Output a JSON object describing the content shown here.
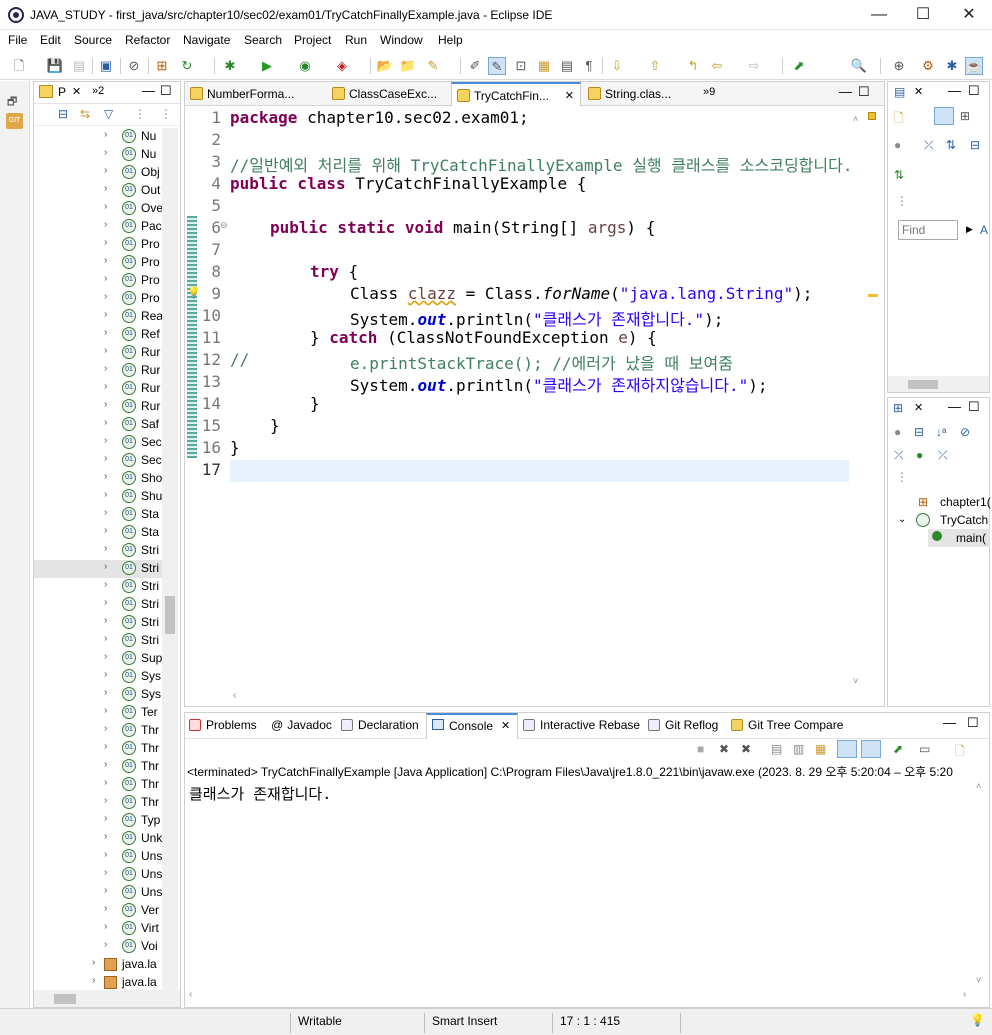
{
  "window": {
    "title": "JAVA_STUDY - first_java/src/chapter10/sec02/exam01/TryCatchFinallyExample.java - Eclipse IDE",
    "minimize": "—",
    "maximize": "☐",
    "close": "✕"
  },
  "menu": [
    "File",
    "Edit",
    "Source",
    "Refactor",
    "Navigate",
    "Search",
    "Project",
    "Run",
    "Window",
    "Help"
  ],
  "package_explorer": {
    "tab_label": "P",
    "tab_extra": "»2",
    "items": [
      "Nu",
      "Nu",
      "Obj",
      "Out",
      "Ove",
      "Pac",
      "Pro",
      "Pro",
      "Pro",
      "Pro",
      "Rea",
      "Ref",
      "Rur",
      "Rur",
      "Rur",
      "Rur",
      "Saf",
      "Sec",
      "Sec",
      "Sho",
      "Shu",
      "Sta",
      "Sta",
      "Stri",
      "Stri",
      "Stri",
      "Stri",
      "Stri",
      "Stri",
      "Sup",
      "Sys",
      "Sys",
      "Ter",
      "Thr",
      "Thr",
      "Thr",
      "Thr",
      "Thr",
      "Typ",
      "Unk",
      "Uns",
      "Uns",
      "Uns",
      "Ver",
      "Virt",
      "Voi"
    ],
    "packages": [
      "java.la",
      "java.la"
    ]
  },
  "editor": {
    "tabs": [
      {
        "label": "NumberForma..."
      },
      {
        "label": "ClassCaseExc..."
      },
      {
        "label": "TryCatchFin...",
        "close": "✕"
      },
      {
        "label": "String.clas..."
      }
    ],
    "overflow": "»9",
    "lines": [
      "1",
      "2",
      "3",
      "4",
      "5",
      "6",
      "7",
      "8",
      "9",
      "10",
      "11",
      "12",
      "13",
      "14",
      "15",
      "16",
      "17"
    ],
    "code": {
      "l1_kw": "package",
      "l1_rest": " chapter10.sec02.exam01;",
      "l3": "//일반예외 처리를 위해 TryCatchFinallyExample 실행 클래스를 소스코딩합니다.",
      "l4_kw": "public class",
      "l4_rest": " TryCatchFinallyExample {",
      "l6_kw": "public static void",
      "l6_rest": " main(String[] ",
      "l6_var": "args",
      "l6_end": ") {",
      "l8_kw": "try",
      "l8_rest": " {",
      "l9_a": "Class ",
      "l9_var": "clazz",
      "l9_b": " = Class.",
      "l9_m": "forName",
      "l9_c": "(",
      "l9_str": "\"java.lang.String\"",
      "l9_d": ");",
      "l10_a": "System.",
      "l10_fld": "out",
      "l10_b": ".println(",
      "l10_str": "\"클래스가 존재합니다.\"",
      "l10_c": ");",
      "l11_a": "} ",
      "l11_kw": "catch",
      "l11_b": " (ClassNotFoundException ",
      "l11_var": "e",
      "l11_c": ") {",
      "l12_cm1": "//",
      "l12_cm2": "e.printStackTrace(); //에러가 났을 때 보여줌",
      "l13_a": "System.",
      "l13_fld": "out",
      "l13_b": ".println(",
      "l13_str": "\"클래스가 존재하지않습니다.\"",
      "l13_c": ");",
      "l14": "}",
      "l15": "}",
      "l16": "}"
    }
  },
  "right_top": {
    "find_placeholder": "Find",
    "find_extra": "A"
  },
  "outline": {
    "items": [
      "chapter1(",
      "TryCatch",
      "main("
    ]
  },
  "console": {
    "tabs": [
      "Problems",
      "Javadoc",
      "Declaration",
      "Console",
      "Interactive Rebase",
      "Git Reflog",
      "Git Tree Compare"
    ],
    "header": "<terminated> TryCatchFinallyExample [Java Application] C:\\Program Files\\Java\\jre1.8.0_221\\bin\\javaw.exe  (2023. 8. 29 오후 5:20:04 – 오후 5:20",
    "output": "클래스가 존재합니다."
  },
  "status": {
    "writable": "Writable",
    "insert_mode": "Smart Insert",
    "position": "17 : 1 : 415"
  }
}
